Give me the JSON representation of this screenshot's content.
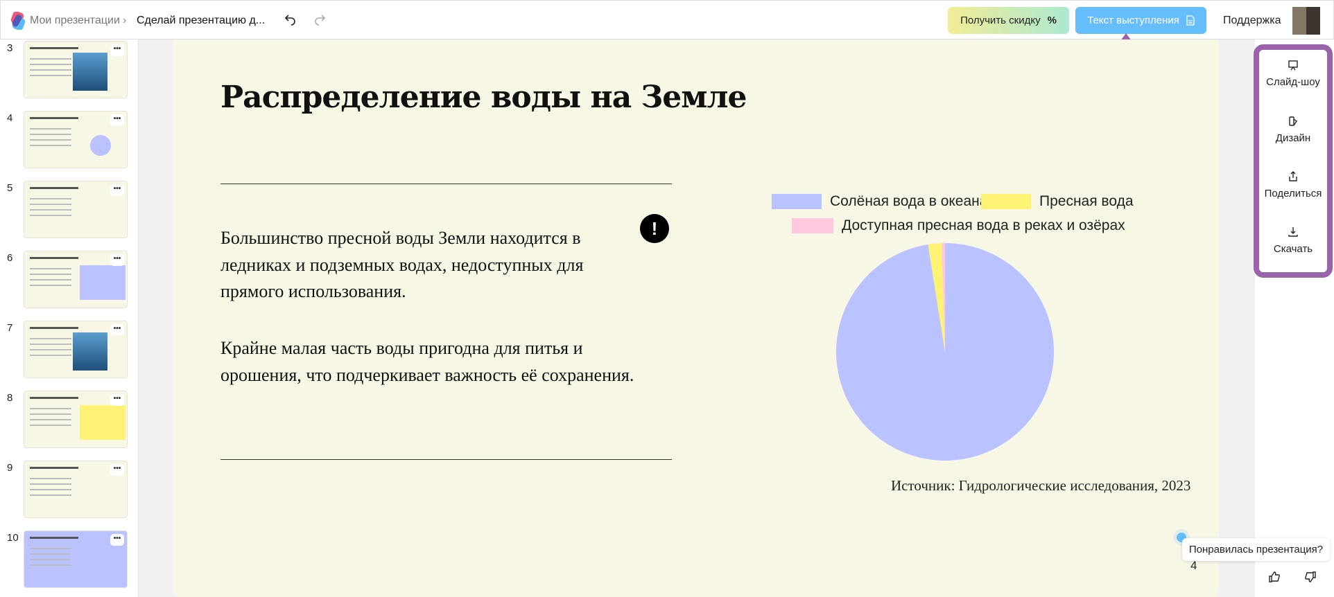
{
  "header": {
    "home_link": "Мои презентации",
    "presentation_title": "Сделай презентацию д...",
    "discount_button": "Получить скидку",
    "discount_icon": "%",
    "speech_button": "Текст выступления",
    "support_link": "Поддержка"
  },
  "sidebar": {
    "slides": [
      {
        "number": "3"
      },
      {
        "number": "4"
      },
      {
        "number": "5"
      },
      {
        "number": "6"
      },
      {
        "number": "7"
      },
      {
        "number": "8"
      },
      {
        "number": "9"
      },
      {
        "number": "10"
      }
    ],
    "menu_glyph": "•••"
  },
  "slide": {
    "title": "Распределение воды на Земле",
    "paragraph1": "Большинство пресной воды Земли находится в ледниках и подземных водах, недоступных для прямого использования.",
    "paragraph2": "Крайне малая часть воды пригодна для питья и орошения, что подчеркивает важность её сохранения.",
    "alert_glyph": "!",
    "source": "Источник: Гидрологические исследования, 2023",
    "page_number": "4"
  },
  "chart_data": {
    "type": "pie",
    "legend_placement": "top",
    "series": [
      {
        "name": "Солёная вода в океанах",
        "value": 97.5,
        "color": "#bac3ff"
      },
      {
        "name": "Пресная вода",
        "value": 2.0,
        "color": "#fdf274"
      },
      {
        "name": "Доступная пресная вода в реках и озёрах",
        "value": 0.5,
        "color": "#ffc8de"
      }
    ]
  },
  "right_panel": {
    "items": [
      {
        "label": "Слайд-шоу"
      },
      {
        "label": "Дизайн"
      },
      {
        "label": "Поделиться"
      },
      {
        "label": "Скачать"
      }
    ]
  },
  "feedback": {
    "question": "Понравилась презентация?"
  },
  "colors": {
    "accent": "#9b64aa",
    "speech_button": "#66bdfc",
    "slide_bg": "#f8f7e6"
  }
}
